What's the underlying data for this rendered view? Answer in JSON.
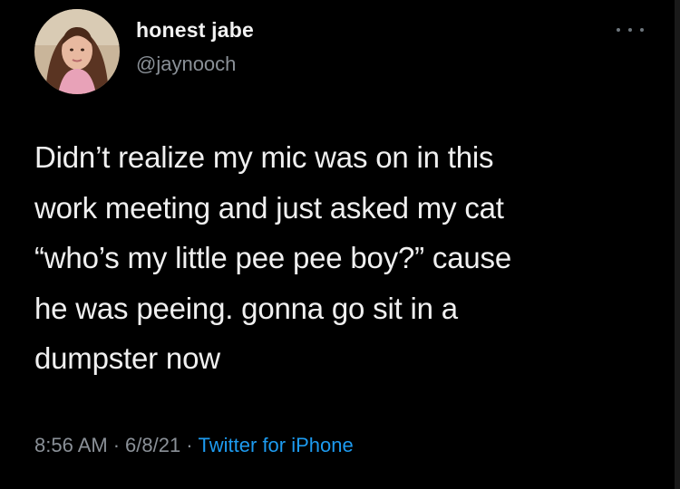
{
  "user": {
    "display_name": "honest jabe",
    "handle": "@jaynooch",
    "avatar_icon": "profile-photo"
  },
  "tweet": {
    "text_lines": [
      "Didn’t realize my mic was on in this",
      "work meeting and just asked my cat",
      "“who’s my little pee pee boy?” cause",
      "he was peeing. gonna go sit in a",
      "dumpster now"
    ],
    "time": "8:56 AM",
    "date": "6/8/21",
    "separator": "·",
    "source": "Twitter for iPhone"
  },
  "icons": {
    "more": "more-options-icon"
  },
  "colors": {
    "background": "#000000",
    "text": "#f0f0f0",
    "secondary": "#8a9097",
    "accent": "#1d9bf0"
  }
}
